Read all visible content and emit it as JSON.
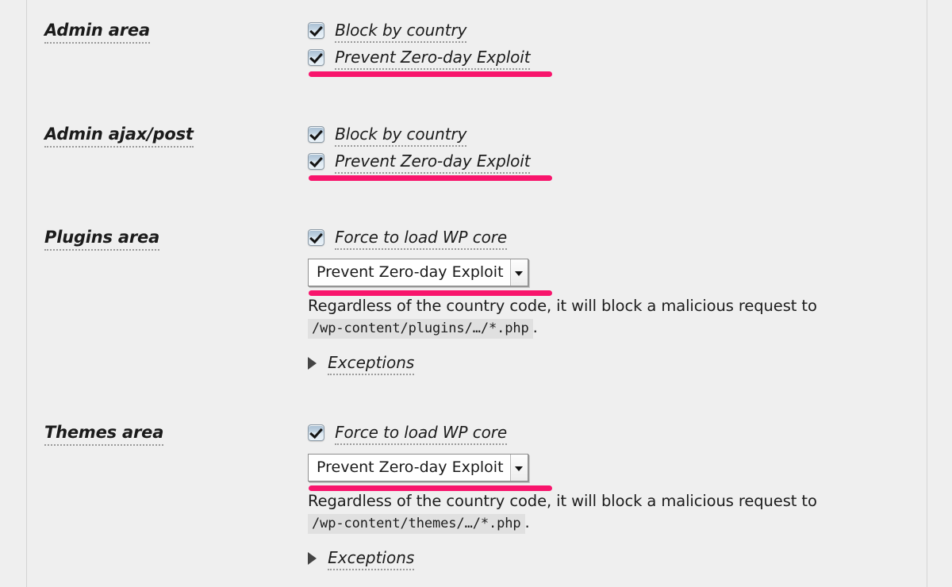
{
  "page": {
    "background_color": "#efefef",
    "accent_color": "#f8156c",
    "divider_color": "#d4d4d4"
  },
  "rows": [
    {
      "id": "admin-area",
      "label": "Admin area",
      "checkboxes": [
        {
          "label": "Block by country",
          "checked": true,
          "highlighted": false
        },
        {
          "label": "Prevent Zero-day Exploit",
          "checked": true,
          "highlighted": true
        }
      ]
    },
    {
      "id": "admin-ajax-post",
      "label": "Admin ajax/post",
      "checkboxes": [
        {
          "label": "Block by country",
          "checked": true,
          "highlighted": false
        },
        {
          "label": "Prevent Zero-day Exploit",
          "checked": true,
          "highlighted": true
        }
      ]
    },
    {
      "id": "plugins-area",
      "label": "Plugins area",
      "checkboxes": [
        {
          "label": "Force to load WP core",
          "checked": true,
          "highlighted": false
        }
      ],
      "select": {
        "value": "Prevent Zero-day Exploit",
        "highlighted": true,
        "icon": "chevron-down-icon"
      },
      "description_before": "Regardless of the country code, it will block a malicious request to",
      "description_code": "/wp-content/plugins/…/*.php",
      "description_after": ".",
      "exceptions": {
        "label": "Exceptions",
        "icon": "disclosure-triangle-icon",
        "expanded": false
      }
    },
    {
      "id": "themes-area",
      "label": "Themes area",
      "checkboxes": [
        {
          "label": "Force to load WP core",
          "checked": true,
          "highlighted": false
        }
      ],
      "select": {
        "value": "Prevent Zero-day Exploit",
        "highlighted": true,
        "icon": "chevron-down-icon"
      },
      "description_before": "Regardless of the country code, it will block a malicious request to",
      "description_code": "/wp-content/themes/…/*.php",
      "description_after": ".",
      "exceptions": {
        "label": "Exceptions",
        "icon": "disclosure-triangle-icon",
        "expanded": false
      }
    }
  ]
}
